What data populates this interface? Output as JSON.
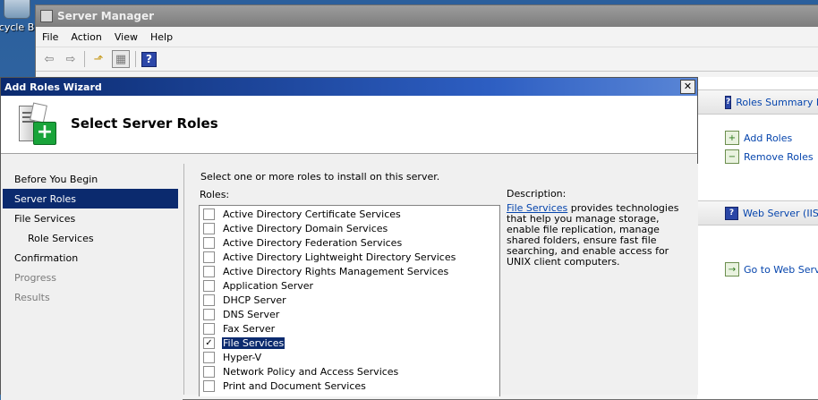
{
  "desktop": {
    "recycle_label": "ecycle Bin"
  },
  "server_manager": {
    "title": "Server Manager",
    "menu": [
      "File",
      "Action",
      "View",
      "Help"
    ],
    "right_sections": {
      "roles_summary": "Roles Summary H",
      "add_roles": "Add Roles",
      "remove_roles": "Remove Roles",
      "web_server": "Web Server (IIS)",
      "go_to_web": "Go to Web Serve"
    }
  },
  "wizard": {
    "title": "Add Roles Wizard",
    "close_glyph": "✕",
    "header_title": "Select Server Roles",
    "nav": [
      {
        "label": "Before You Begin",
        "state": "normal"
      },
      {
        "label": "Server Roles",
        "state": "selected"
      },
      {
        "label": "File Services",
        "state": "normal"
      },
      {
        "label": "Role Services",
        "state": "sub"
      },
      {
        "label": "Confirmation",
        "state": "normal"
      },
      {
        "label": "Progress",
        "state": "disabled"
      },
      {
        "label": "Results",
        "state": "disabled"
      }
    ],
    "instruction": "Select one or more roles to install on this server.",
    "roles_label": "Roles:",
    "roles": [
      {
        "label": "Active Directory Certificate Services",
        "checked": false
      },
      {
        "label": "Active Directory Domain Services",
        "checked": false
      },
      {
        "label": "Active Directory Federation Services",
        "checked": false
      },
      {
        "label": "Active Directory Lightweight Directory Services",
        "checked": false
      },
      {
        "label": "Active Directory Rights Management Services",
        "checked": false
      },
      {
        "label": "Application Server",
        "checked": false
      },
      {
        "label": "DHCP Server",
        "checked": false
      },
      {
        "label": "DNS Server",
        "checked": false
      },
      {
        "label": "Fax Server",
        "checked": false
      },
      {
        "label": "File Services",
        "checked": true,
        "selected": true
      },
      {
        "label": "Hyper-V",
        "checked": false
      },
      {
        "label": "Network Policy and Access Services",
        "checked": false
      },
      {
        "label": "Print and Document Services",
        "checked": false
      }
    ],
    "description_label": "Description:",
    "description_link": "File Services",
    "description_text": " provides technologies that help you manage storage, enable file replication, manage shared folders, ensure fast file searching, and enable access for UNIX client computers."
  }
}
